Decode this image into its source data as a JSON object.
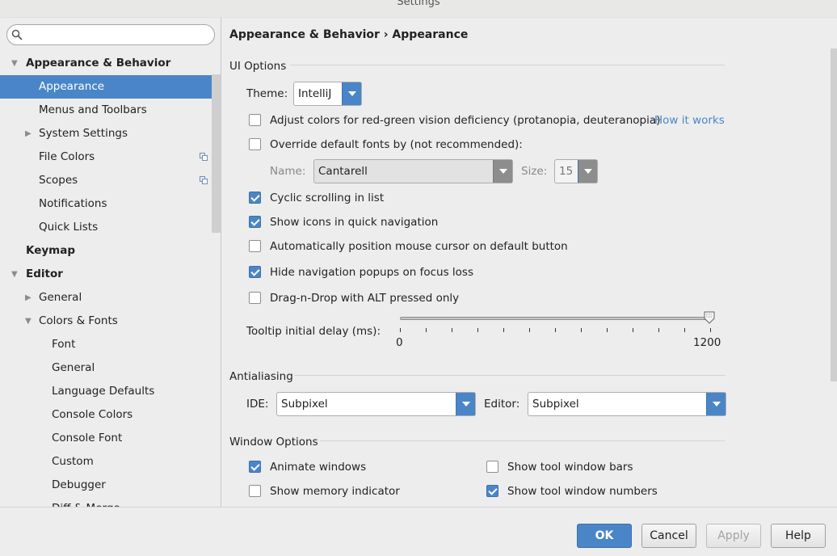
{
  "window": {
    "title": "Settings"
  },
  "search": {
    "placeholder": ""
  },
  "sidebar": {
    "items": [
      {
        "label": "Appearance & Behavior",
        "level": 0,
        "arrow": "down"
      },
      {
        "label": "Appearance",
        "level": 1,
        "selected": true
      },
      {
        "label": "Menus and Toolbars",
        "level": 1
      },
      {
        "label": "System Settings",
        "level": 1,
        "arrow": "right"
      },
      {
        "label": "File Colors",
        "level": 1,
        "icon": "copy-icon"
      },
      {
        "label": "Scopes",
        "level": 1,
        "icon": "copy-icon"
      },
      {
        "label": "Notifications",
        "level": 1
      },
      {
        "label": "Quick Lists",
        "level": 1
      },
      {
        "label": "Keymap",
        "level": 0
      },
      {
        "label": "Editor",
        "level": 0,
        "arrow": "down"
      },
      {
        "label": "General",
        "level": 1,
        "arrow": "right"
      },
      {
        "label": "Colors & Fonts",
        "level": 1,
        "arrow": "down"
      },
      {
        "label": "Font",
        "level": 2
      },
      {
        "label": "General",
        "level": 2
      },
      {
        "label": "Language Defaults",
        "level": 2
      },
      {
        "label": "Console Colors",
        "level": 2
      },
      {
        "label": "Console Font",
        "level": 2
      },
      {
        "label": "Custom",
        "level": 2
      },
      {
        "label": "Debugger",
        "level": 2
      },
      {
        "label": "Diff & Merge",
        "level": 2
      }
    ]
  },
  "breadcrumb": "Appearance & Behavior › Appearance",
  "ui_options": {
    "title": "UI Options",
    "theme_label": "Theme:",
    "theme_value": "IntelliJ",
    "adjust_colors": {
      "label": "Adjust colors for red-green vision deficiency (protanopia, deuteranopia)",
      "checked": false
    },
    "how_it_works": "How it works",
    "override_fonts": {
      "label": "Override default fonts by (not recommended):",
      "checked": false
    },
    "name_label": "Name:",
    "name_value": "Cantarell",
    "size_label": "Size:",
    "size_value": "15",
    "cyclic": {
      "label": "Cyclic scrolling in list",
      "checked": true
    },
    "show_icons": {
      "label": "Show icons in quick navigation",
      "checked": true
    },
    "auto_position": {
      "label": "Automatically position mouse cursor on default button",
      "checked": false
    },
    "hide_popups": {
      "label": "Hide navigation popups on focus loss",
      "checked": true
    },
    "drag_drop": {
      "label": "Drag-n-Drop with ALT pressed only",
      "checked": false
    },
    "tooltip_label": "Tooltip initial delay (ms):",
    "tooltip_min": "0",
    "tooltip_max": "1200",
    "tooltip_value": 1200
  },
  "antialiasing": {
    "title": "Antialiasing",
    "ide_label": "IDE:",
    "ide_value": "Subpixel",
    "editor_label": "Editor:",
    "editor_value": "Subpixel"
  },
  "window_options": {
    "title": "Window Options",
    "animate": {
      "label": "Animate windows",
      "checked": true
    },
    "memory": {
      "label": "Show memory indicator",
      "checked": false
    },
    "tool_bars": {
      "label": "Show tool window bars",
      "checked": false
    },
    "tool_numbers": {
      "label": "Show tool window numbers",
      "checked": true
    }
  },
  "footer": {
    "ok": "OK",
    "cancel": "Cancel",
    "apply": "Apply",
    "help": "Help"
  },
  "colors": {
    "accent": "#4a86c7",
    "selection": "#4a86c7",
    "background": "#ededed"
  }
}
